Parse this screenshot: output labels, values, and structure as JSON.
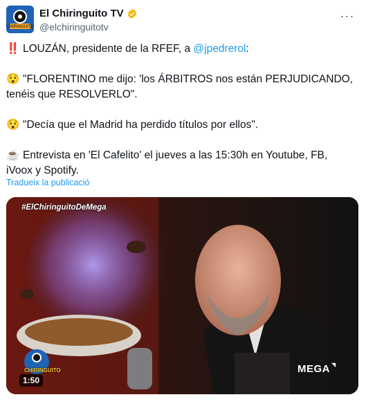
{
  "account": {
    "display_name": "El Chiringuito TV",
    "handle": "@elchiringuitotv",
    "verified": true,
    "avatar_icon": "chiringuito-logo-icon"
  },
  "tweet": {
    "line1_prefix": "LOUZÁN, presidente de la RFEF, a ",
    "line1_mention": "@jpedrerol",
    "line1_suffix": ":",
    "line2": "\"FLORENTINO me dijo: 'los ÁRBITROS nos están PERJUDICANDO, tenéis que RESOLVERLO\".",
    "line3": "\"Decía que el Madrid ha perdido títulos por ellos\".",
    "line4": "Entrevista en 'El Cafelito' el jueves a las 15:30h en Youtube, FB, iVoox y Spotify.",
    "emoji_1": "‼️",
    "emoji_2": "😯",
    "emoji_3": "😯",
    "emoji_4": "☕"
  },
  "translate_label": "Tradueix la publicació",
  "media": {
    "hashtag": "#ElChiringuitoDeMega",
    "duration": "1:50",
    "channel_logo": "MEGA",
    "logo_caption": "CHIRINGUITO"
  },
  "colors": {
    "link": "#1d9bf0",
    "verified_badge": "#f5b400",
    "text": "#0f1419",
    "secondary": "#536471"
  }
}
